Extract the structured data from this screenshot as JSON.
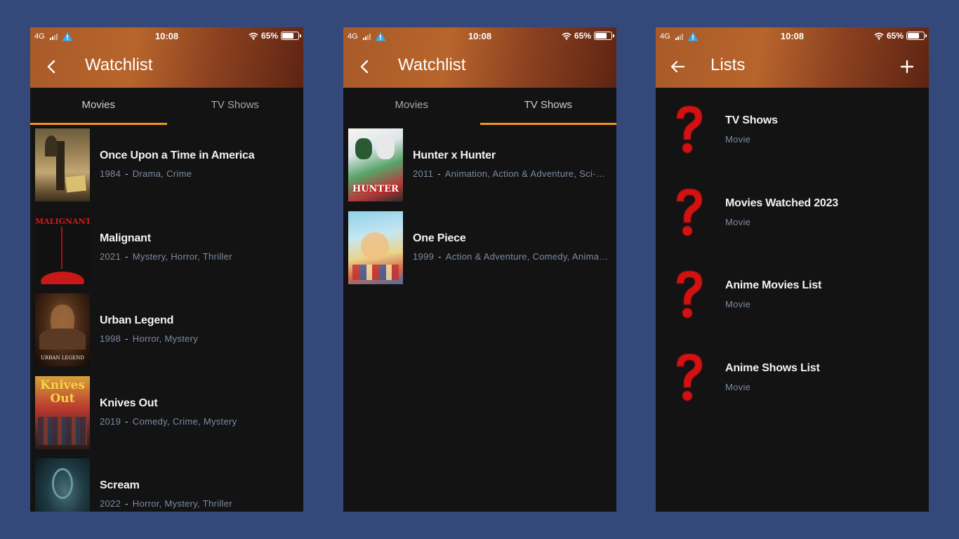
{
  "status_bar": {
    "network": "4G",
    "time": "10:08",
    "battery": "65%",
    "battery_level": 0.65
  },
  "watchlist_movies": {
    "title": "Watchlist",
    "tabs": [
      {
        "label": "Movies"
      },
      {
        "label": "TV Shows"
      }
    ],
    "active_tab": "Movies",
    "items": [
      {
        "title": "Once Upon a Time in America",
        "year": "1984",
        "genres": "Drama, Crime",
        "poster_text": ""
      },
      {
        "title": "Malignant",
        "year": "2021",
        "genres": "Mystery, Horror, Thriller",
        "poster_text": "MALIGNANT"
      },
      {
        "title": "Urban Legend",
        "year": "1998",
        "genres": "Horror, Mystery",
        "poster_text": "URBAN LEGEND"
      },
      {
        "title": "Knives Out",
        "year": "2019",
        "genres": "Comedy, Crime, Mystery",
        "poster_text": "Knives Out"
      },
      {
        "title": "Scream",
        "year": "2022",
        "genres": "Horror, Mystery, Thriller",
        "poster_text": ""
      }
    ]
  },
  "watchlist_tv": {
    "title": "Watchlist",
    "tabs": [
      {
        "label": "Movies"
      },
      {
        "label": "TV Shows"
      }
    ],
    "active_tab": "TV Shows",
    "items": [
      {
        "title": "Hunter x Hunter",
        "year": "2011",
        "genres": "Animation, Action & Adventure, Sci-Fi & Fantasy",
        "poster_text": "HUNTER"
      },
      {
        "title": "One Piece",
        "year": "1999",
        "genres": "Action & Adventure, Comedy, Animation",
        "poster_text": ""
      }
    ]
  },
  "lists": {
    "title": "Lists",
    "items": [
      {
        "name": "TV Shows",
        "type": "Movie"
      },
      {
        "name": "Movies Watched 2023",
        "type": "Movie"
      },
      {
        "name": "Anime Movies List",
        "type": "Movie"
      },
      {
        "name": "Anime Shows List",
        "type": "Movie"
      }
    ]
  },
  "icons": {
    "back": "chevron-left-icon",
    "back_arrow": "arrow-left-icon",
    "add": "plus-icon",
    "warning": "warning-icon",
    "wifi": "wifi-icon",
    "battery": "battery-icon",
    "placeholder": "question-mark-icon"
  },
  "colors": {
    "background": "#34497a",
    "screen": "#131313",
    "appbar_start": "#b8652c",
    "appbar_end": "#5e2412",
    "tab_indicator": "#f0951e",
    "subtitle": "#7c8ba1",
    "question_mark": "#d01212"
  }
}
